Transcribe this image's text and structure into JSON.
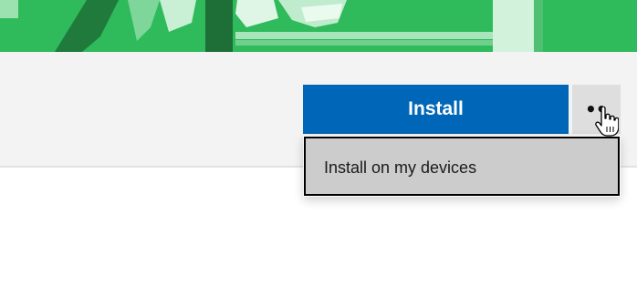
{
  "hero": {
    "accent_color": "#2fba5b",
    "image_kind": "app-banner-photo-tinted-green"
  },
  "actions": {
    "install_label": "Install",
    "install_color": "#0067b8",
    "more_label": "••",
    "more_icon": "more-options-icon"
  },
  "dropdown": {
    "items": [
      {
        "label": "Install on my devices"
      }
    ]
  },
  "cursor": {
    "icon": "hand-pointer-icon"
  }
}
